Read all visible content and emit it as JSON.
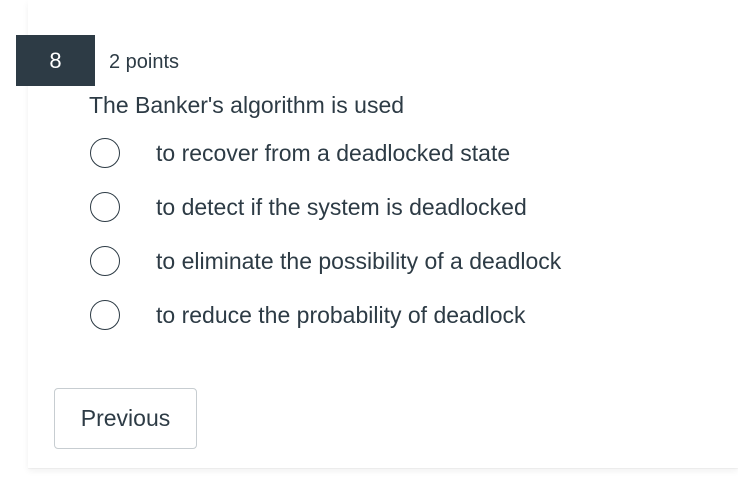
{
  "question": {
    "number": "8",
    "points": "2 points",
    "text": "The Banker's algorithm is used",
    "answers": [
      {
        "label": "to recover from a deadlocked state",
        "selected": false
      },
      {
        "label": "to detect if the system is deadlocked",
        "selected": false
      },
      {
        "label": "to eliminate the possibility of a deadlock",
        "selected": false
      },
      {
        "label": "to reduce the probability of deadlock",
        "selected": false
      }
    ]
  },
  "nav": {
    "previous_label": "Previous"
  },
  "colors": {
    "number_badge_bg": "#2d3b45",
    "text": "#2d3b45",
    "button_border": "#c7cdd1"
  }
}
